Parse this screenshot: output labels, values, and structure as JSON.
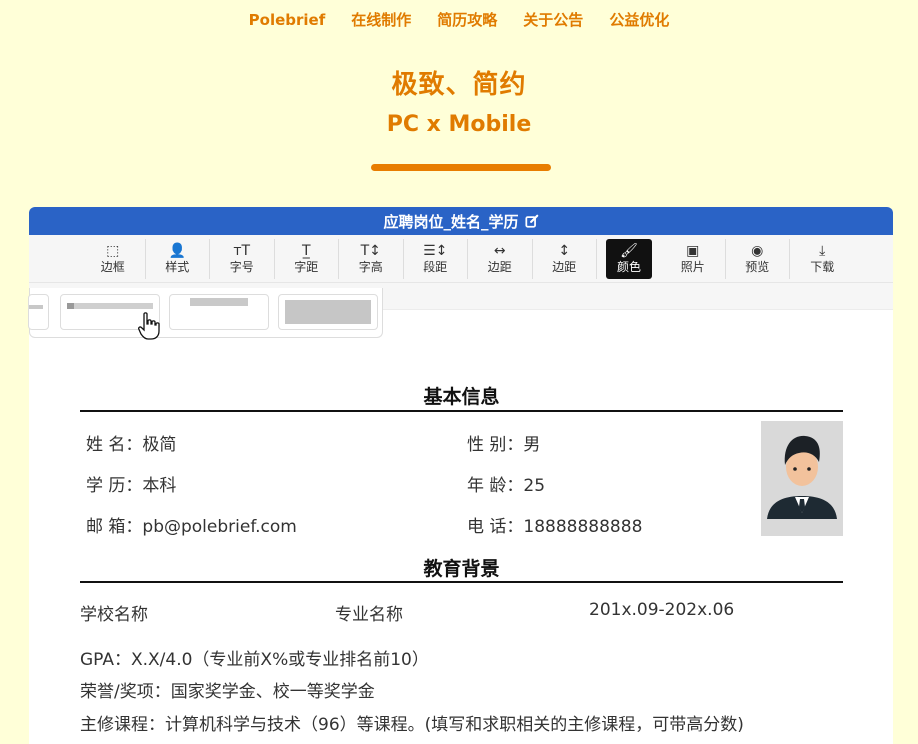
{
  "nav": [
    "Polebrief",
    "在线制作",
    "简历攻略",
    "关于公告",
    "公益优化"
  ],
  "hero": {
    "title": "极致、简约",
    "subtitle": "PC x Mobile"
  },
  "editor": {
    "title": "应聘岗位_姓名_学历",
    "tools": [
      {
        "icon": "border-icon",
        "glyph": "⬚",
        "label": "边框"
      },
      {
        "icon": "user-icon",
        "glyph": "👤",
        "label": "样式"
      },
      {
        "icon": "font-size-icon",
        "glyph": "тT",
        "label": "字号"
      },
      {
        "icon": "letter-spacing-icon",
        "glyph": "T̲",
        "label": "字距"
      },
      {
        "icon": "line-height-icon",
        "glyph": "T↕",
        "label": "字高"
      },
      {
        "icon": "paragraph-spacing-icon",
        "glyph": "☰↕",
        "label": "段距"
      },
      {
        "icon": "horizontal-margin-icon",
        "glyph": "↔",
        "label": "边距"
      },
      {
        "icon": "vertical-margin-icon",
        "glyph": "↕",
        "label": "边距"
      },
      {
        "icon": "paint-bucket-icon",
        "glyph": "🖌",
        "label": "颜色"
      },
      {
        "icon": "image-icon",
        "glyph": "▣",
        "label": "照片"
      },
      {
        "icon": "eye-icon",
        "glyph": "◉",
        "label": "预览"
      },
      {
        "icon": "download-icon",
        "glyph": "⤓",
        "label": "下载"
      }
    ]
  },
  "resume": {
    "basic": {
      "title": "基本信息",
      "name": "姓 名：极简",
      "gender": "性 别：男",
      "education": "学 历：本科",
      "age": "年 龄：25",
      "email": "邮 箱：pb@polebrief.com",
      "phone": "电 话：18888888888"
    },
    "edu": {
      "title": "教育背景",
      "school": "学校名称",
      "major": "专业名称",
      "period": "201x.09-202x.06",
      "gpa": "GPA：X.X/4.0（专业前X%或专业排名前10）",
      "honors": "荣誉/奖项：国家奖学金、校一等奖学金",
      "courses": "主修课程：计算机科学与技术（96）等课程。(填写和求职相关的主修课程，可带高分数)"
    }
  }
}
